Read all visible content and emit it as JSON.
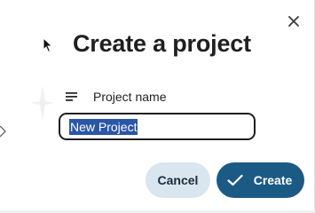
{
  "dialog": {
    "title": "Create a project",
    "field": {
      "label": "Project name",
      "value": "New Project",
      "icon": "lines-icon"
    },
    "buttons": {
      "cancel_label": "Cancel",
      "create_label": "Create"
    },
    "icons": {
      "close": "close-icon",
      "create": "check-icon"
    }
  },
  "colors": {
    "primary": "#1c5a86",
    "secondary_button": "#d9e6ef",
    "selection": "#2a56a6",
    "text": "#1f1f1f"
  }
}
